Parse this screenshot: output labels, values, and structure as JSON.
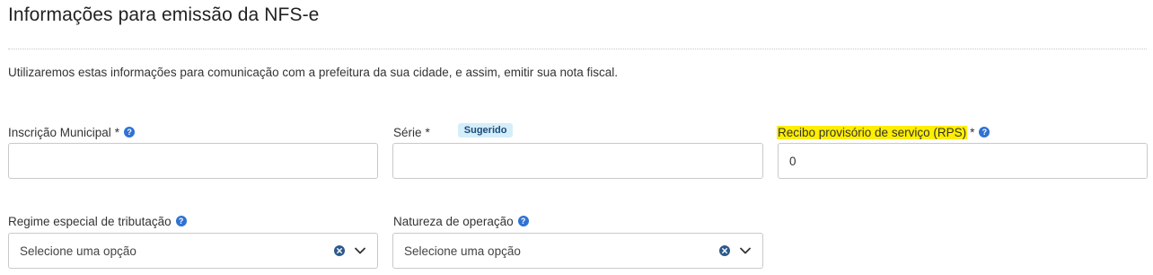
{
  "page": {
    "title": "Informações para emissão da NFS-e",
    "description": "Utilizaremos estas informações para comunicação com a prefeitura da sua cidade, e assim, emitir sua nota fiscal."
  },
  "fields": {
    "inscricao": {
      "label": "Inscrição Municipal",
      "required": "*",
      "value": ""
    },
    "serie": {
      "label": "Série",
      "required": "*",
      "badge": "Sugerido",
      "value": ""
    },
    "rps": {
      "label": "Recibo provisório de serviço (RPS)",
      "required": "*",
      "value": "0"
    },
    "regime": {
      "label": "Regime especial de tributação",
      "selected": "Selecione uma opção"
    },
    "natureza": {
      "label": "Natureza de operação",
      "selected": "Selecione uma opção"
    }
  },
  "icons": {
    "help": "question-mark-circle-icon",
    "clear": "close-circle-icon",
    "dropdown": "chevron-down-icon"
  },
  "colors": {
    "help_icon": "#2f72d3",
    "badge_bg": "#d4eefa",
    "highlight": "#ffee00",
    "clear_icon": "#2d5a8c"
  }
}
